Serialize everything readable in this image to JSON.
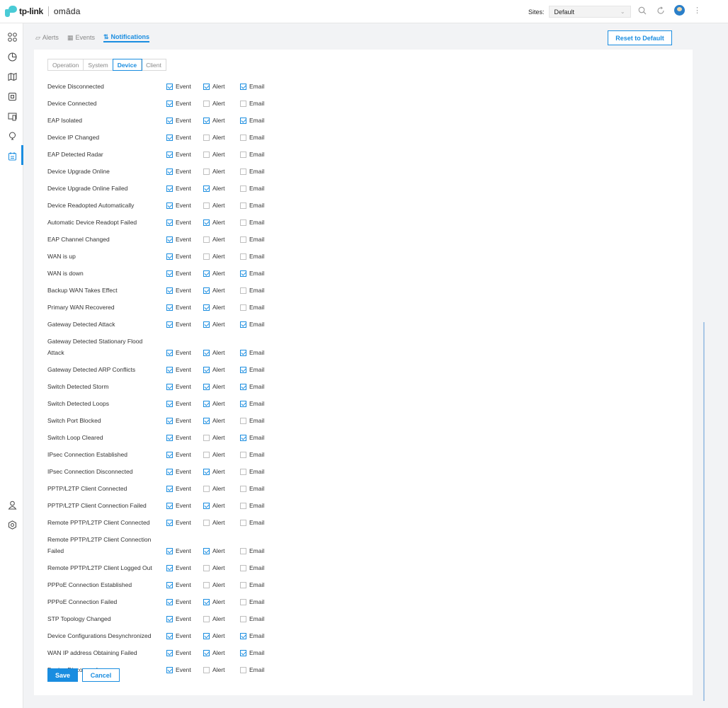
{
  "header": {
    "brand": "tp-link",
    "product": "omāda",
    "sites_label": "Sites:",
    "sites_value": "Default"
  },
  "icons": {
    "search": "search-icon",
    "refresh": "refresh-icon",
    "avatar": "avatar",
    "more": "more-icon"
  },
  "sidebar": {
    "items": [
      "dashboard-icon",
      "statistics-icon",
      "map-icon",
      "devices-icon",
      "clients-icon",
      "insight-icon",
      "log-icon",
      "account-icon",
      "settings-icon"
    ],
    "active_index": 6
  },
  "tabs": [
    {
      "label": "Alerts",
      "active": false
    },
    {
      "label": "Events",
      "active": false
    },
    {
      "label": "Notifications",
      "active": true
    }
  ],
  "reset_label": "Reset to Default",
  "subtabs": [
    {
      "label": "Operation",
      "active": false
    },
    {
      "label": "System",
      "active": false
    },
    {
      "label": "Device",
      "active": true
    },
    {
      "label": "Client",
      "active": false
    }
  ],
  "column_labels": {
    "event": "Event",
    "alert": "Alert",
    "email": "Email"
  },
  "rows": [
    {
      "label": "Device Disconnected",
      "event": true,
      "alert": true,
      "email": true
    },
    {
      "label": "Device Connected",
      "event": true,
      "alert": false,
      "email": false
    },
    {
      "label": "EAP Isolated",
      "event": true,
      "alert": true,
      "email": true
    },
    {
      "label": "Device IP Changed",
      "event": true,
      "alert": false,
      "email": false
    },
    {
      "label": "EAP Detected Radar",
      "event": true,
      "alert": false,
      "email": false
    },
    {
      "label": "Device Upgrade Online",
      "event": true,
      "alert": false,
      "email": false
    },
    {
      "label": "Device Upgrade Online Failed",
      "event": true,
      "alert": true,
      "email": false
    },
    {
      "label": "Device Readopted Automatically",
      "event": true,
      "alert": false,
      "email": false
    },
    {
      "label": "Automatic Device Readopt Failed",
      "event": true,
      "alert": true,
      "email": false
    },
    {
      "label": "EAP Channel Changed",
      "event": true,
      "alert": false,
      "email": false
    },
    {
      "label": "WAN is up",
      "event": true,
      "alert": false,
      "email": false
    },
    {
      "label": "WAN is down",
      "event": true,
      "alert": true,
      "email": true
    },
    {
      "label": "Backup WAN Takes Effect",
      "event": true,
      "alert": true,
      "email": false
    },
    {
      "label": "Primary WAN Recovered",
      "event": true,
      "alert": true,
      "email": false
    },
    {
      "label": "Gateway Detected Attack",
      "event": true,
      "alert": true,
      "email": true
    },
    {
      "label": "Gateway Detected Stationary Flood Attack",
      "event": true,
      "alert": true,
      "email": true
    },
    {
      "label": "Gateway Detected ARP Conflicts",
      "event": true,
      "alert": true,
      "email": true
    },
    {
      "label": "Switch Detected Storm",
      "event": true,
      "alert": true,
      "email": true
    },
    {
      "label": "Switch Detected Loops",
      "event": true,
      "alert": true,
      "email": true
    },
    {
      "label": "Switch Port Blocked",
      "event": true,
      "alert": true,
      "email": false
    },
    {
      "label": "Switch Loop Cleared",
      "event": true,
      "alert": false,
      "email": true
    },
    {
      "label": "IPsec Connection Established",
      "event": true,
      "alert": false,
      "email": false
    },
    {
      "label": "IPsec Connection Disconnected",
      "event": true,
      "alert": true,
      "email": false
    },
    {
      "label": "PPTP/L2TP Client Connected",
      "event": true,
      "alert": false,
      "email": false
    },
    {
      "label": "PPTP/L2TP Client Connection Failed",
      "event": true,
      "alert": true,
      "email": false
    },
    {
      "label": "Remote PPTP/L2TP Client Connected",
      "event": true,
      "alert": false,
      "email": false
    },
    {
      "label": "Remote PPTP/L2TP Client Connection Failed",
      "event": true,
      "alert": true,
      "email": false
    },
    {
      "label": "Remote PPTP/L2TP Client Logged Out",
      "event": true,
      "alert": false,
      "email": false
    },
    {
      "label": "PPPoE Connection Established",
      "event": true,
      "alert": false,
      "email": false
    },
    {
      "label": "PPPoE Connection Failed",
      "event": true,
      "alert": true,
      "email": false
    },
    {
      "label": "STP Topology Changed",
      "event": true,
      "alert": false,
      "email": false
    },
    {
      "label": "Device Configurations Desynchronized",
      "event": true,
      "alert": true,
      "email": true
    },
    {
      "label": "WAN IP address Obtaining Failed",
      "event": true,
      "alert": true,
      "email": true
    },
    {
      "label": "Device Discovered",
      "event": true,
      "alert": false,
      "email": false
    }
  ],
  "save_label": "Save",
  "cancel_label": "Cancel"
}
